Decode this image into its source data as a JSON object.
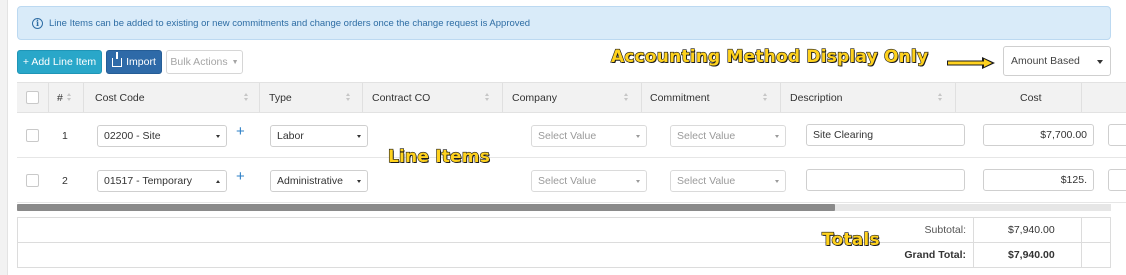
{
  "banner": {
    "text": "Line Items can be added to existing or new commitments and change orders once the change request is Approved",
    "icon": "info-icon"
  },
  "toolbar": {
    "add_label": "+ Add Line Item",
    "import_label": "Import",
    "bulk_label": "Bulk Actions"
  },
  "annotations": {
    "accounting": "Accounting Method Display Only",
    "line_items": "Line Items",
    "totals": "Totals",
    "color": "#ffd21e"
  },
  "accounting_method": {
    "value": "Amount Based"
  },
  "table": {
    "headers": {
      "num": "#",
      "cost_code": "Cost Code",
      "type": "Type",
      "contract_co": "Contract CO",
      "company": "Company",
      "commitment": "Commitment",
      "description": "Description",
      "cost": "Cost"
    },
    "rows": [
      {
        "num": "1",
        "cost_code": "02200 - Site",
        "type": "Labor",
        "company": "Select Value",
        "commitment": "Select Value",
        "description": "Site Clearing",
        "cost": "$7,700.00"
      },
      {
        "num": "2",
        "cost_code": "01517 - Temporary",
        "type": "Administrative",
        "company": "Select Value",
        "commitment": "Select Value",
        "description": "",
        "cost": "$125."
      }
    ]
  },
  "totals": {
    "subtotal_label": "Subtotal:",
    "subtotal_value": "$7,940.00",
    "grand_label": "Grand Total:",
    "grand_value": "$7,940.00"
  },
  "colors": {
    "primary_button": "#29a7c9",
    "import_button": "#2e6aa8",
    "banner_bg": "#d9ebf9",
    "link_blue": "#2e80c7"
  }
}
